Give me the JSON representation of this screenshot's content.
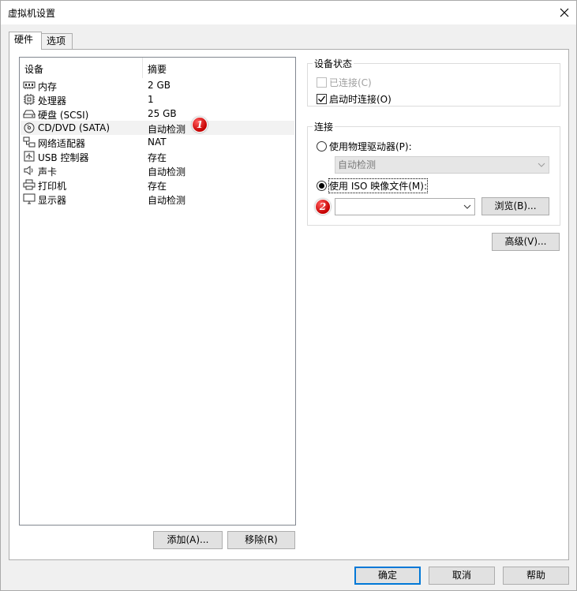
{
  "window": {
    "title": "虚拟机设置"
  },
  "tabs": [
    {
      "label": "硬件",
      "active": true
    },
    {
      "label": "选项",
      "active": false
    }
  ],
  "device_list": {
    "columns": [
      "设备",
      "摘要"
    ],
    "rows": [
      {
        "name": "内存",
        "summary": "2 GB",
        "icon": "memory-icon"
      },
      {
        "name": "处理器",
        "summary": "1",
        "icon": "processor-icon"
      },
      {
        "name": "硬盘 (SCSI)",
        "summary": "25 GB",
        "icon": "hard-disk-icon"
      },
      {
        "name": "CD/DVD (SATA)",
        "summary": "自动检测",
        "icon": "cd-dvd-icon",
        "selected": true
      },
      {
        "name": "网络适配器",
        "summary": "NAT",
        "icon": "network-adapter-icon"
      },
      {
        "name": "USB 控制器",
        "summary": "存在",
        "icon": "usb-icon"
      },
      {
        "name": "声卡",
        "summary": "自动检测",
        "icon": "sound-card-icon"
      },
      {
        "name": "打印机",
        "summary": "存在",
        "icon": "printer-icon"
      },
      {
        "name": "显示器",
        "summary": "自动检测",
        "icon": "display-icon"
      }
    ]
  },
  "list_buttons": {
    "add": "添加(A)...",
    "remove": "移除(R)"
  },
  "device_status": {
    "label": "设备状态",
    "connected": {
      "label": "已连接(C)",
      "checked": false,
      "disabled": true
    },
    "connect_on_power_on": {
      "label": "启动时连接(O)",
      "checked": true
    }
  },
  "connection": {
    "label": "连接",
    "physical_drive": {
      "label": "使用物理驱动器(P):",
      "selected": false
    },
    "physical_drive_select": {
      "value": "自动检测"
    },
    "iso_image": {
      "label": "使用 ISO 映像文件(M):",
      "selected": true
    },
    "iso_path": {
      "value": ""
    },
    "browse": "浏览(B)..."
  },
  "advanced": "高级(V)...",
  "badges": {
    "one": "1",
    "two": "2"
  },
  "footer": {
    "ok": "确定",
    "cancel": "取消",
    "help": "帮助"
  },
  "colors": {
    "accent": "#0078d7",
    "badge": "#d10000"
  }
}
